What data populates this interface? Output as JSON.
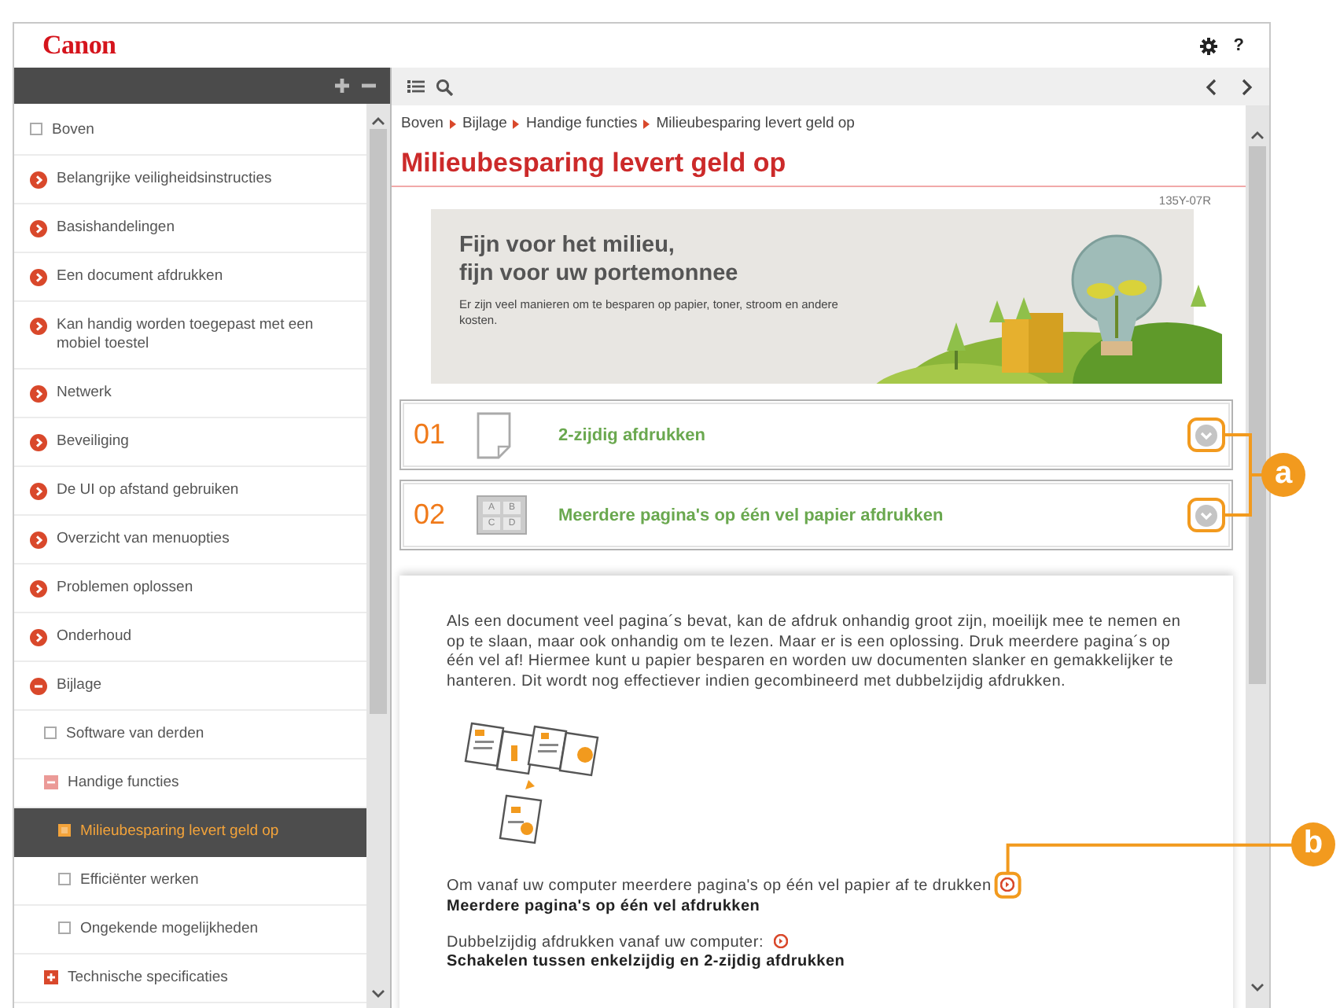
{
  "header": {
    "logo": "Canon",
    "help": "?"
  },
  "sidebar": {
    "items": [
      {
        "kind": "page",
        "label": "Boven",
        "selected": false
      },
      {
        "kind": "chapter",
        "label": "Belangrijke veiligheidsinstructies",
        "expanded": false,
        "selected": false
      },
      {
        "kind": "chapter",
        "label": "Basishandelingen",
        "expanded": false,
        "selected": false
      },
      {
        "kind": "chapter",
        "label": "Een document afdrukken",
        "expanded": false,
        "selected": false
      },
      {
        "kind": "chapter",
        "label": "Kan handig worden toegepast met een mobiel toestel",
        "expanded": false,
        "selected": false
      },
      {
        "kind": "chapter",
        "label": "Netwerk",
        "expanded": false,
        "selected": false
      },
      {
        "kind": "chapter",
        "label": "Beveiliging",
        "expanded": false,
        "selected": false
      },
      {
        "kind": "chapter",
        "label": "De UI op afstand gebruiken",
        "expanded": false,
        "selected": false
      },
      {
        "kind": "chapter",
        "label": "Overzicht van menuopties",
        "expanded": false,
        "selected": false
      },
      {
        "kind": "chapter",
        "label": "Problemen oplossen",
        "expanded": false,
        "selected": false
      },
      {
        "kind": "chapter",
        "label": "Onderhoud",
        "expanded": false,
        "selected": false
      },
      {
        "kind": "chapter",
        "label": "Bijlage",
        "expanded": true,
        "selected": false,
        "children": [
          {
            "kind": "page",
            "label": "Software van derden",
            "selected": false
          },
          {
            "kind": "section",
            "label": "Handige functies",
            "expanded": true,
            "selected": false,
            "children": [
              {
                "kind": "page",
                "label": "Milieubesparing levert geld op",
                "selected": true
              },
              {
                "kind": "page",
                "label": "Efficiënter werken",
                "selected": false
              },
              {
                "kind": "page",
                "label": "Ongekende mogelijkheden",
                "selected": false
              }
            ]
          },
          {
            "kind": "section",
            "label": "Technische specificaties",
            "expanded": false,
            "selected": false
          }
        ]
      }
    ]
  },
  "breadcrumb": [
    "Boven",
    "Bijlage",
    "Handige functies",
    "Milieubesparing levert geld op"
  ],
  "title": "Milieubesparing levert geld op",
  "doc_code": "135Y-07R",
  "banner": {
    "headline": [
      "Fijn voor het milieu,",
      "fijn voor uw portemonnee"
    ],
    "text": "Er zijn veel manieren om te besparen op papier, toner, stroom en andere kosten."
  },
  "topics": [
    {
      "number": "01",
      "kind": "duplex",
      "title": "2-zijdig afdrukken",
      "expanded": false
    },
    {
      "number": "02",
      "kind": "nup",
      "thumb_labels": [
        "A",
        "B",
        "C",
        "D"
      ],
      "title": "Meerdere pagina's op één vel papier afdrukken",
      "expanded": false
    }
  ],
  "body": {
    "paragraph": "Als een document veel pagina´s bevat, kan de afdruk onhandig groot zijn, moeilijk mee te nemen en op te slaan, maar ook onhandig om te lezen. Maar er is een oplossing. Druk meerdere pagina´s op één vel af! Hiermee kunt u papier besparen en worden uw documenten slanker en gemakkelijker te hanteren. Dit wordt nog effectiever indien gecombineerd met dubbelzijdig afdrukken.",
    "links": [
      {
        "text": "Om vanaf uw computer meerdere pagina's op één vel papier af te drukken",
        "link": "Meerdere pagina's op één vel afdrukken"
      },
      {
        "text": "Dubbelzijdig afdrukken vanaf uw computer:",
        "link": "Schakelen tussen enkelzijdig en 2-zijdig afdrukken"
      }
    ]
  },
  "callouts": [
    {
      "label": "a"
    },
    {
      "label": "b"
    }
  ]
}
